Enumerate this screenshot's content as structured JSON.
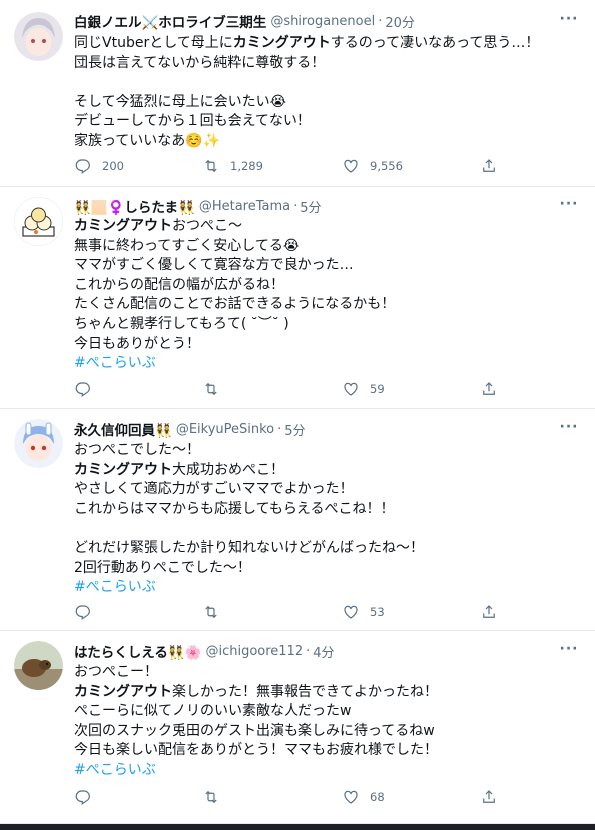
{
  "tweets": [
    {
      "name": "白銀ノエル⚔️ホロライブ三期生",
      "handle": "@shiroganenoel",
      "time": "20分",
      "lines": [
        {
          "pre": "同じVtuberとして母上に",
          "bold": "カミングアウト",
          "post": "するのって凄いなあって思う…！"
        },
        {
          "pre": "団長は言えてないから純粋に尊敬する！",
          "bold": "",
          "post": ""
        },
        {
          "pre": "",
          "bold": "",
          "post": ""
        },
        {
          "pre": "そして今猛烈に母上に会いたい😭",
          "bold": "",
          "post": ""
        },
        {
          "pre": "デビューしてから１回も会えてない！",
          "bold": "",
          "post": ""
        },
        {
          "pre": "家族っていいなあ☺️✨",
          "bold": "",
          "post": ""
        }
      ],
      "hashtag": "",
      "reply": "200",
      "retweet": "1,289",
      "like": "9,556"
    },
    {
      "name": "👯🏻♀️しらたま👯",
      "handle": "@HetareTama",
      "time": "5分",
      "lines": [
        {
          "pre": "",
          "bold": "カミングアウト",
          "post": "おつぺこ〜"
        },
        {
          "pre": "無事に終わってすごく安心してる😭",
          "bold": "",
          "post": ""
        },
        {
          "pre": "ママがすごく優しくて寛容な方で良かった…",
          "bold": "",
          "post": ""
        },
        {
          "pre": "これからの配信の幅が広がるね！",
          "bold": "",
          "post": ""
        },
        {
          "pre": "たくさん配信のことでお話できるようになるかも！",
          "bold": "",
          "post": ""
        },
        {
          "pre": "ちゃんと親孝行してもろて( ˘︶˘ )",
          "bold": "",
          "post": ""
        },
        {
          "pre": "今日もありがとう！",
          "bold": "",
          "post": ""
        }
      ],
      "hashtag": "#ぺこらいぶ",
      "reply": "",
      "retweet": "",
      "like": "59"
    },
    {
      "name": "永久信仰回員👯",
      "handle": "@EikyuPeSinko",
      "time": "5分",
      "lines": [
        {
          "pre": "おつぺこでした〜！",
          "bold": "",
          "post": ""
        },
        {
          "pre": "",
          "bold": "カミングアウト",
          "post": "大成功おめぺこ！"
        },
        {
          "pre": "やさしくて適応力がすごいママでよかった！",
          "bold": "",
          "post": ""
        },
        {
          "pre": "これからはママからも応援してもらえるぺこね！！",
          "bold": "",
          "post": ""
        },
        {
          "pre": "",
          "bold": "",
          "post": ""
        },
        {
          "pre": "どれだけ緊張したか計り知れないけどがんばったね〜！",
          "bold": "",
          "post": ""
        },
        {
          "pre": "2回行動ありぺこでした〜！",
          "bold": "",
          "post": ""
        }
      ],
      "hashtag": "#ぺこらいぶ",
      "reply": "",
      "retweet": "",
      "like": "53"
    },
    {
      "name": "はたらくしえる👯🌸",
      "handle": "@ichigoore112",
      "time": "4分",
      "lines": [
        {
          "pre": "おつぺこー！",
          "bold": "",
          "post": ""
        },
        {
          "pre": "",
          "bold": "カミングアウト",
          "post": "楽しかった！無事報告できてよかったね！"
        },
        {
          "pre": "ぺこーらに似てノリのいい素敵な人だったw",
          "bold": "",
          "post": ""
        },
        {
          "pre": "次回のスナック兎田のゲスト出演も楽しみに待ってるねw",
          "bold": "",
          "post": ""
        },
        {
          "pre": "今日も楽しい配信をありがとう！ママもお疲れ様でした！",
          "bold": "",
          "post": ""
        }
      ],
      "hashtag": "#ぺこらいぶ",
      "reply": "",
      "retweet": "",
      "like": "68"
    }
  ],
  "colors": {
    "text": "#0f1419",
    "secondary": "#5b7083",
    "link": "#1da1f2",
    "divider": "#e1e8ed"
  },
  "icons": [
    "more-icon",
    "reply-icon",
    "retweet-icon",
    "like-icon",
    "share-icon"
  ]
}
